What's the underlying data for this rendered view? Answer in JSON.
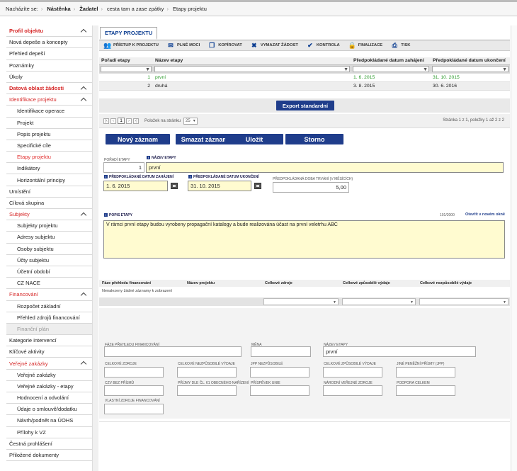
{
  "breadcrumb": [
    "Nacházíte se:",
    "Nástěnka",
    "Žadatel",
    "cesta tam a zase zpátky",
    "Etapy projektu"
  ],
  "sidebar": [
    {
      "label": "Profil objektu",
      "type": "sec",
      "chev": true
    },
    {
      "label": "Nová depeše a koncepty",
      "type": "top"
    },
    {
      "label": "Přehled depeší",
      "type": "top"
    },
    {
      "label": "Poznámky",
      "type": "top"
    },
    {
      "label": "Úkoly",
      "type": "top"
    },
    {
      "label": "Datová oblast žádosti",
      "type": "sec",
      "chev": true
    },
    {
      "label": "Identifikace projektu",
      "type": "sec2",
      "chev": true
    },
    {
      "label": "Identifikace operace",
      "type": "l2"
    },
    {
      "label": "Projekt",
      "type": "l2"
    },
    {
      "label": "Popis projektu",
      "type": "l2"
    },
    {
      "label": "Specifické cíle",
      "type": "l2"
    },
    {
      "label": "Etapy projektu",
      "type": "l2 active"
    },
    {
      "label": "Indikátory",
      "type": "l2"
    },
    {
      "label": "Horizontální principy",
      "type": "l2"
    },
    {
      "label": "Umístění",
      "type": "top"
    },
    {
      "label": "Cílová skupina",
      "type": "top"
    },
    {
      "label": "Subjekty",
      "type": "sec2",
      "chev": true
    },
    {
      "label": "Subjekty projektu",
      "type": "l2"
    },
    {
      "label": "Adresy subjektu",
      "type": "l2"
    },
    {
      "label": "Osoby subjektu",
      "type": "l2"
    },
    {
      "label": "Účty subjektu",
      "type": "l2"
    },
    {
      "label": "Účetní období",
      "type": "l2"
    },
    {
      "label": "CZ NACE",
      "type": "l2"
    },
    {
      "label": "Financování",
      "type": "sec2",
      "chev": true
    },
    {
      "label": "Rozpočet základní",
      "type": "l2"
    },
    {
      "label": "Přehled zdrojů financování",
      "type": "l2"
    },
    {
      "label": "Finanční plán",
      "type": "l2 dis"
    },
    {
      "label": "Kategorie intervencí",
      "type": "top"
    },
    {
      "label": "Klíčové aktivity",
      "type": "top"
    },
    {
      "label": "Veřejné zakázky",
      "type": "sec2",
      "chev": true
    },
    {
      "label": "Veřejné zakázky",
      "type": "l2"
    },
    {
      "label": "Veřejné zakázky - etapy",
      "type": "l2"
    },
    {
      "label": "Hodnocení a odvolání",
      "type": "l2"
    },
    {
      "label": "Údaje o smlouvě/dodatku",
      "type": "l2"
    },
    {
      "label": "Návrh/podnět na ÚOHS",
      "type": "l2"
    },
    {
      "label": "Přílohy k VZ",
      "type": "l2"
    },
    {
      "label": "Čestná prohlášení",
      "type": "top"
    },
    {
      "label": "Přiložené dokumenty",
      "type": "top"
    }
  ],
  "tab_label": "ETAPY PROJEKTU",
  "toolbar": [
    {
      "label": "PŘÍSTUP K PROJEKTU",
      "icon": "people-icon"
    },
    {
      "label": "PLNÉ MOCI",
      "icon": "envelope-icon"
    },
    {
      "label": "KOPÍROVAT",
      "icon": "copy-icon"
    },
    {
      "label": "VYMAZAT ŽÁDOST",
      "icon": "close-icon"
    },
    {
      "label": "KONTROLA",
      "icon": "check-icon"
    },
    {
      "label": "FINALIZACE",
      "icon": "lock-icon"
    },
    {
      "label": "TISK",
      "icon": "print-icon"
    }
  ],
  "table": {
    "headers": [
      "Pořadí etapy",
      "Název etapy",
      "Předpokládané datum zahájení",
      "Předpokládané datum ukončení"
    ],
    "rows": [
      [
        "1",
        "první",
        "1. 6. 2015",
        "31. 10. 2015"
      ],
      [
        "2",
        "druhá",
        "3. 8. 2015",
        "30. 6. 2016"
      ]
    ]
  },
  "export_label": "Export standardní",
  "pager": {
    "page": "1",
    "per_page_label": "Položek na stránku",
    "per_page": "25",
    "info": "Stránka 1 z 1, položky 1 až 2 z 2"
  },
  "buttons": {
    "new": "Nový záznam",
    "delete": "Smazat záznam",
    "save": "Uložit",
    "cancel": "Storno"
  },
  "form": {
    "poradi_label": "POŘADÍ ETAPY",
    "poradi_value": "1",
    "nazev_label": "NÁZEV ETAPY",
    "nazev_value": "první",
    "start_label": "PŘEDPOKLÁDANÉ DATUM ZAHÁJENÍ",
    "start_value": "1. 6. 2015",
    "end_label": "PŘEDPOKLÁDANÉ DATUM UKONČENÍ",
    "end_value": "31. 10. 2015",
    "duration_label": "PŘEDPOKLÁDANÁ DOBA TRVÁNÍ (V MĚSÍCÍCH)",
    "duration_value": "5,00",
    "popis_label": "POPIS ETAPY",
    "popis_count": "101/2000",
    "popis_link": "Otevřít v novém okně",
    "popis_value": "V rámci první etapy budou vyrobeny propagační katalogy a bude realizována účast na první veletrhu ABC"
  },
  "fin_table": {
    "headers": [
      "Fáze přehledu financování",
      "Název projektu",
      "Celkové zdroje",
      "Celkové způsobilé výdaje",
      "Celkové nezpůsobilé výdaje"
    ],
    "empty": "Nenalezeny žádné záznamy k zobrazení"
  },
  "fin_form": {
    "faze": "FÁZE PŘEHLEDU FINANCOVÁNÍ",
    "mena": "MĚNA",
    "nazev_etapy": "NÁZEV ETAPY",
    "nazev_etapy_value": "první",
    "celk_zdroje": "CELKOVÉ ZDROJE",
    "celk_nezp": "CELKOVÉ NEZPŮSOBILÉ VÝDAJE",
    "jpp_nezp": "JPP NEZPŮSOBILÉ",
    "celk_zp": "CELKOVÉ ZPŮSOBILÉ VÝDAJE",
    "jine": "JINÉ PENĚŽNÍ PŘÍJMY (JPP)",
    "czv": "CZV BEZ PŘÍJMŮ",
    "prijmy": "PŘÍJMY DLE ČL. 61 OBECNÉHO NAŘÍZENÍ",
    "eu": "PŘÍSPĚVEK UNIE",
    "narodni": "NÁRODNÍ VEŘEJNÉ ZDROJE",
    "podpora": "PODPORA CELKEM",
    "vlastni": "VLASTNÍ ZDROJE FINANCOVÁNÍ"
  },
  "colors": {
    "brand": "#1f3d8b",
    "red": "#d62828",
    "green": "#2a9a2a",
    "yellow": "#fffbd0"
  }
}
